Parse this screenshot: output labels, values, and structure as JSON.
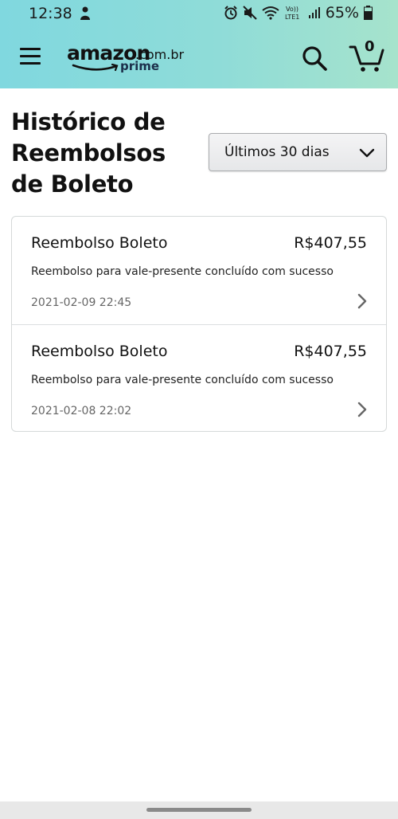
{
  "status_bar": {
    "time": "12:38",
    "battery": "65%",
    "network_label": "Vo)) LTE1"
  },
  "header": {
    "logo_word": "amazon",
    "logo_domain": ".com.br",
    "logo_sub": "prime",
    "cart_count": "0"
  },
  "page": {
    "title": "Histórico de Reembolsos de Boleto",
    "filter": {
      "selected": "Últimos 30 dias"
    }
  },
  "refunds": [
    {
      "name": "Reembolso Boleto",
      "amount": "R$407,55",
      "description": "Reembolso para vale-presente concluído com sucesso",
      "date": "2021-02-09 22:45"
    },
    {
      "name": "Reembolso Boleto",
      "amount": "R$407,55",
      "description": "Reembolso para vale-presente concluído com sucesso",
      "date": "2021-02-08 22:02"
    }
  ],
  "colors": {
    "header_gradient_start": "#80d8df",
    "header_gradient_end": "#a6e3cc",
    "border": "#d5d9d9"
  },
  "icons": [
    "menu-icon",
    "search-icon",
    "cart-icon",
    "chevron-down-icon",
    "chevron-right-icon"
  ]
}
